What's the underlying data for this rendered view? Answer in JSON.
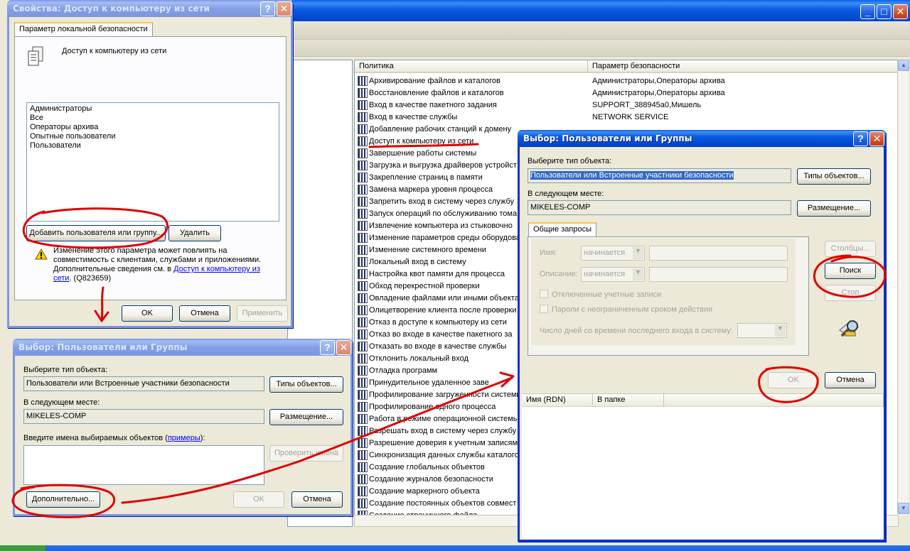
{
  "props_dialog": {
    "title": "Свойства: Доступ к компьютеру из сети",
    "help_glyph": "?",
    "close_glyph": "✕",
    "tab": "Параметр локальной безопасности",
    "policy_name": "Доступ к компьютеру из сети",
    "members": [
      "Администраторы",
      "Все",
      "Операторы архива",
      "Опытные пользователи",
      "Пользователи"
    ],
    "add_button": "Добавить пользователя или группу...",
    "remove_button": "Удалить",
    "warning_line1": "Изменение этого параметра может повлиять на",
    "warning_line2": "совместимость с клиентами, службами и приложениями.",
    "warning_line3": "Дополнительные сведения см. в",
    "warning_link": "Доступ к компьютеру из",
    "warning_link2": "сети",
    "warning_kb": ". (Q823659)",
    "ok": "OK",
    "cancel": "Отмена",
    "apply": "Применить"
  },
  "select_small": {
    "title": "Выбор: Пользователи или Группы",
    "help_glyph": "?",
    "close_glyph": "✕",
    "object_type_label": "Выберите тип объекта:",
    "object_type_value": "Пользователи или Встроенные участники безопасности",
    "object_types_button": "Типы объектов...",
    "location_label": "В следующем месте:",
    "location_value": "MIKELES-COMP",
    "locations_button": "Размещение...",
    "enter_names_label": "Введите имена выбираемых объектов (",
    "examples_link": "примеры",
    "enter_names_suffix": "):",
    "check_names_button": "Проверить имена",
    "advanced_button": "Дополнительно...",
    "ok": "OK",
    "cancel": "Отмена"
  },
  "select_advanced": {
    "title": "Выбор: Пользователи или Группы",
    "help_glyph": "?",
    "close_glyph": "✕",
    "object_type_label": "Выберите тип объекта:",
    "object_type_value": "Пользователи или Встроенные участники безопасности",
    "object_types_button": "Типы объектов...",
    "location_label": "В следующем месте:",
    "location_value": "MIKELES-COMP",
    "locations_button": "Размещение...",
    "tab": "Общие запросы",
    "name_label": "Имя:",
    "description_label": "Описание:",
    "starts_with": "начинается",
    "disabled_accounts": "Отключенные учетные записи",
    "non_expiring_passwords": "Пароли с неограниченным сроком действия",
    "days_since_logon": "Число дней со времени последнего входа в систему:",
    "columns_button": "Столбцы...",
    "search_button": "Поиск",
    "stop_button": "Стоп",
    "ok": "OK",
    "cancel": "Отмена",
    "results_col_name": "Имя (RDN)",
    "results_col_folder": "В папке"
  },
  "mmc": {
    "col_policy": "Политика",
    "col_setting": "Параметр безопасности",
    "minimize_glyph": "_",
    "maximize_glyph": "□",
    "close_glyph": "✕",
    "rows": [
      {
        "name": "Архивирование файлов и каталогов",
        "value": "Администраторы,Операторы архива"
      },
      {
        "name": "Восстановление файлов и каталогов",
        "value": "Администраторы,Операторы архива"
      },
      {
        "name": "Вход в качестве пакетного задания",
        "value": "SUPPORT_388945a0,Мишель"
      },
      {
        "name": "Вход в качестве службы",
        "value": "NETWORK SERVICE"
      },
      {
        "name": "Добавление рабочих станций к домену",
        "value": ""
      },
      {
        "name": "Доступ к компьютеру из сети",
        "value": ""
      },
      {
        "name": "Завершение работы системы",
        "value": ""
      },
      {
        "name": "Загрузка и выгрузка драйверов устройст",
        "value": ""
      },
      {
        "name": "Закрепление страниц в памяти",
        "value": ""
      },
      {
        "name": "Замена маркера уровня процесса",
        "value": ""
      },
      {
        "name": "Запретить вход в систему через службу",
        "value": ""
      },
      {
        "name": "Запуск операций по обслуживанию тома",
        "value": ""
      },
      {
        "name": "Извлечение компьютера из стыковочно",
        "value": ""
      },
      {
        "name": "Изменение параметров среды оборудова",
        "value": ""
      },
      {
        "name": "Изменение системного времени",
        "value": ""
      },
      {
        "name": "Локальный вход в систему",
        "value": ""
      },
      {
        "name": "Настройка квот памяти для процесса",
        "value": ""
      },
      {
        "name": "Обход перекрестной проверки",
        "value": ""
      },
      {
        "name": "Овладение файлами или иными объектам",
        "value": ""
      },
      {
        "name": "Олицетворение клиента после проверки",
        "value": ""
      },
      {
        "name": "Отказ в доступе к компьютеру из сети",
        "value": ""
      },
      {
        "name": "Отказ во входе в качестве пакетного за",
        "value": ""
      },
      {
        "name": "Отказать во входе в качестве службы",
        "value": ""
      },
      {
        "name": "Отклонить локальный вход",
        "value": ""
      },
      {
        "name": "Отладка программ",
        "value": ""
      },
      {
        "name": "Принудительное удаленное заве",
        "value": ""
      },
      {
        "name": "Профилирование загруженности системы",
        "value": ""
      },
      {
        "name": "Профилирование одного процесса",
        "value": ""
      },
      {
        "name": "Работа в режиме операционной системы",
        "value": ""
      },
      {
        "name": "Разрешать вход в систему через службу",
        "value": ""
      },
      {
        "name": "Разрешение доверия к учетным записям",
        "value": ""
      },
      {
        "name": "Синхронизация данных службы каталогов",
        "value": ""
      },
      {
        "name": "Создание глобальных объектов",
        "value": ""
      },
      {
        "name": "Создание журналов безопасности",
        "value": ""
      },
      {
        "name": "Создание маркерного объекта",
        "value": ""
      },
      {
        "name": "Создание постоянных объектов совмест",
        "value": ""
      },
      {
        "name": "Создание страничного файла",
        "value": ""
      }
    ]
  },
  "colors": {
    "xp_title_blue": "#0a5adf",
    "window_face": "#ece9d8",
    "annotation_red": "#e00000"
  }
}
